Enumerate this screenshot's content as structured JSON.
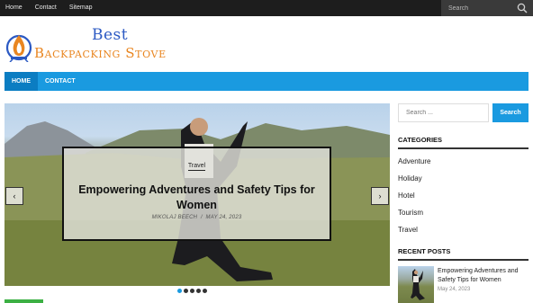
{
  "topbar": {
    "nav": [
      "Home",
      "Contact",
      "Sitemap"
    ],
    "search_placeholder": "Search"
  },
  "logo": {
    "line1": "Best",
    "line2": "Backpacking Stove"
  },
  "mainnav": {
    "items": [
      "HOME",
      "CONTACT"
    ]
  },
  "slider": {
    "category": "Travel",
    "title": "Empowering Adventures and Safety Tips for Women",
    "author": "MIKOLAJ BEECH",
    "separator": "/",
    "date": "MAY 24, 2023",
    "prev_icon": "chevron-left-icon",
    "next_icon": "chevron-right-icon",
    "prev_glyph": "‹",
    "next_glyph": "›",
    "slide_count": 5,
    "active_slide": 1
  },
  "sidebar": {
    "search_placeholder": "Search ...",
    "search_button": "Search",
    "categories_heading": "CATEGORIES",
    "categories": [
      "Adventure",
      "Holiday",
      "Hotel",
      "Tourism",
      "Travel"
    ],
    "recent_heading": "RECENT POSTS",
    "recent_posts": [
      {
        "title": "Empowering Adventures and Safety Tips for Women",
        "date": "May 24, 2023"
      }
    ]
  },
  "colors": {
    "accent": "#1a9ae0",
    "topbar": "#1d1d1d",
    "logo_blue": "#2b59c3",
    "logo_orange": "#e98621"
  }
}
